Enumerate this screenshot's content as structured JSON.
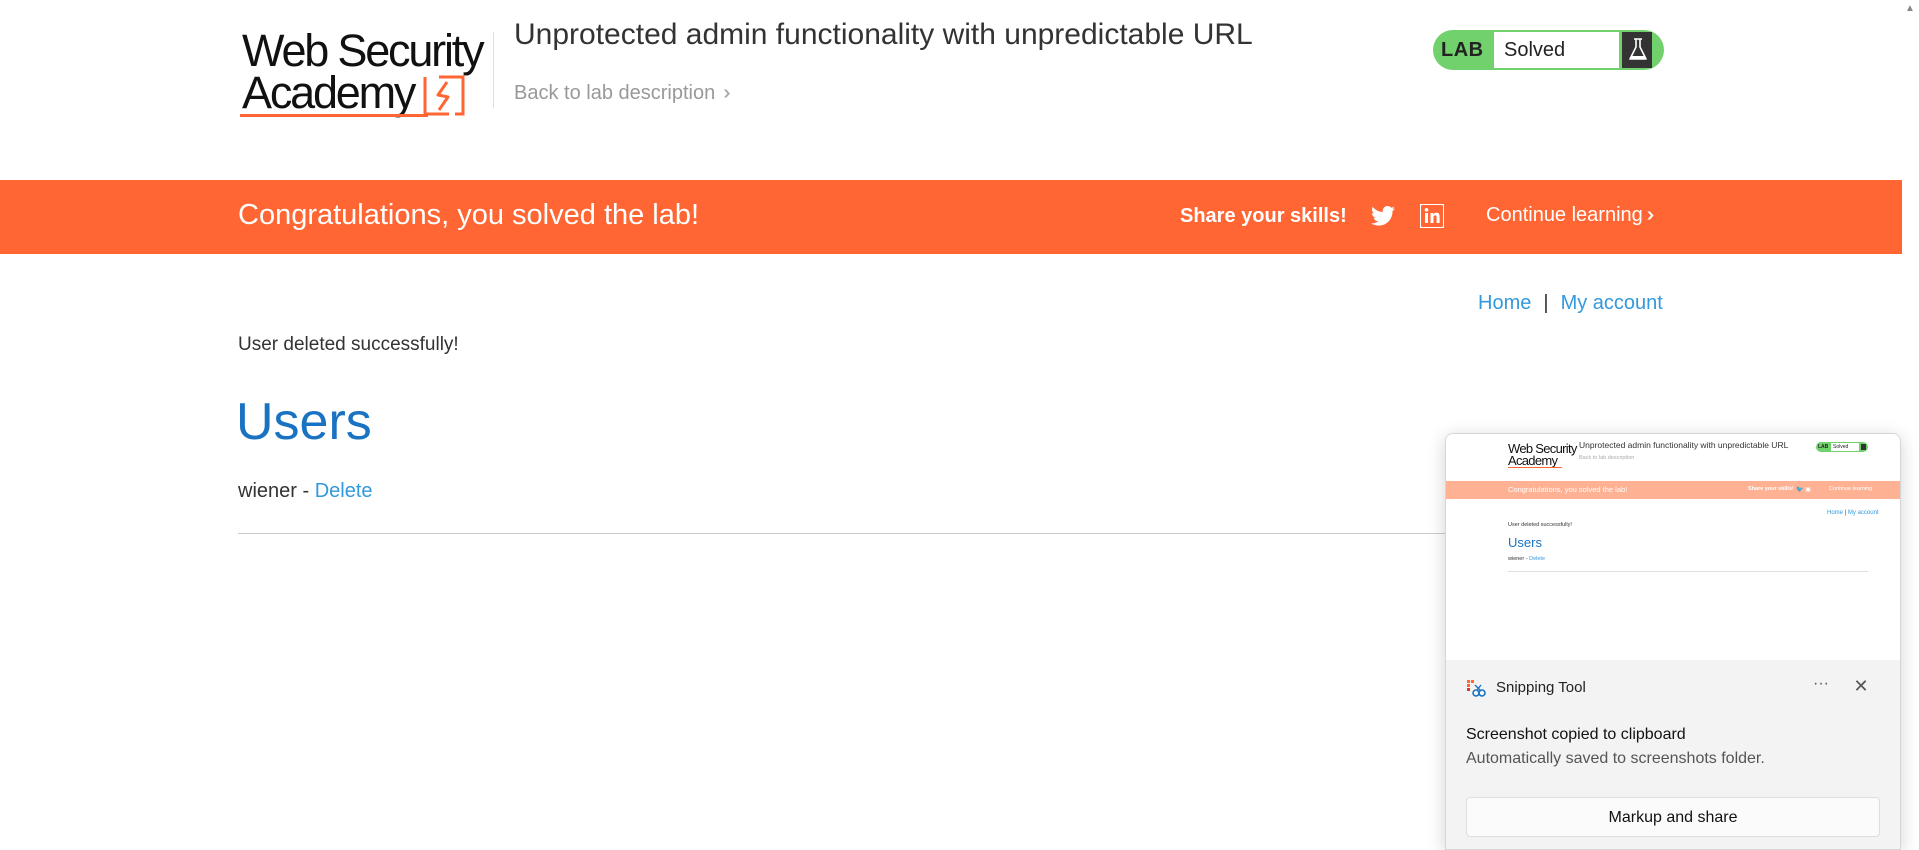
{
  "header": {
    "logo_line1": "Web Security",
    "logo_line2": "Academy",
    "lab_title": "Unprotected admin functionality with unpredictable URL",
    "back_link": "Back to lab description",
    "lab_tag": "LAB",
    "lab_status": "Solved"
  },
  "banner": {
    "message": "Congratulations, you solved the lab!",
    "share_label": "Share your skills!",
    "continue_label": "Continue learning",
    "color": "#ff6633"
  },
  "nav": {
    "home": "Home",
    "separator": "|",
    "my_account": "My account"
  },
  "main": {
    "status_message": "User deleted successfully!",
    "heading": "Users",
    "users": [
      {
        "name": "wiener",
        "separator": "-",
        "action": "Delete"
      }
    ]
  },
  "toast": {
    "app_name": "Snipping Tool",
    "more_label": "···",
    "headline": "Screenshot copied to clipboard",
    "subtext": "Automatically saved to screenshots folder.",
    "button_label": "Markup and share"
  },
  "colors": {
    "accent_orange": "#ff6633",
    "lab_green": "#70d16d",
    "link_blue": "#3399dd",
    "heading_blue": "#1a73c2"
  },
  "icons": {
    "logo_mark": "lightning-bracket-icon",
    "back_chevron": "double-chevron-right-icon",
    "flask": "flask-icon",
    "twitter": "twitter-icon",
    "linkedin": "linkedin-icon",
    "snipping": "snipping-tool-icon",
    "close": "close-icon"
  }
}
